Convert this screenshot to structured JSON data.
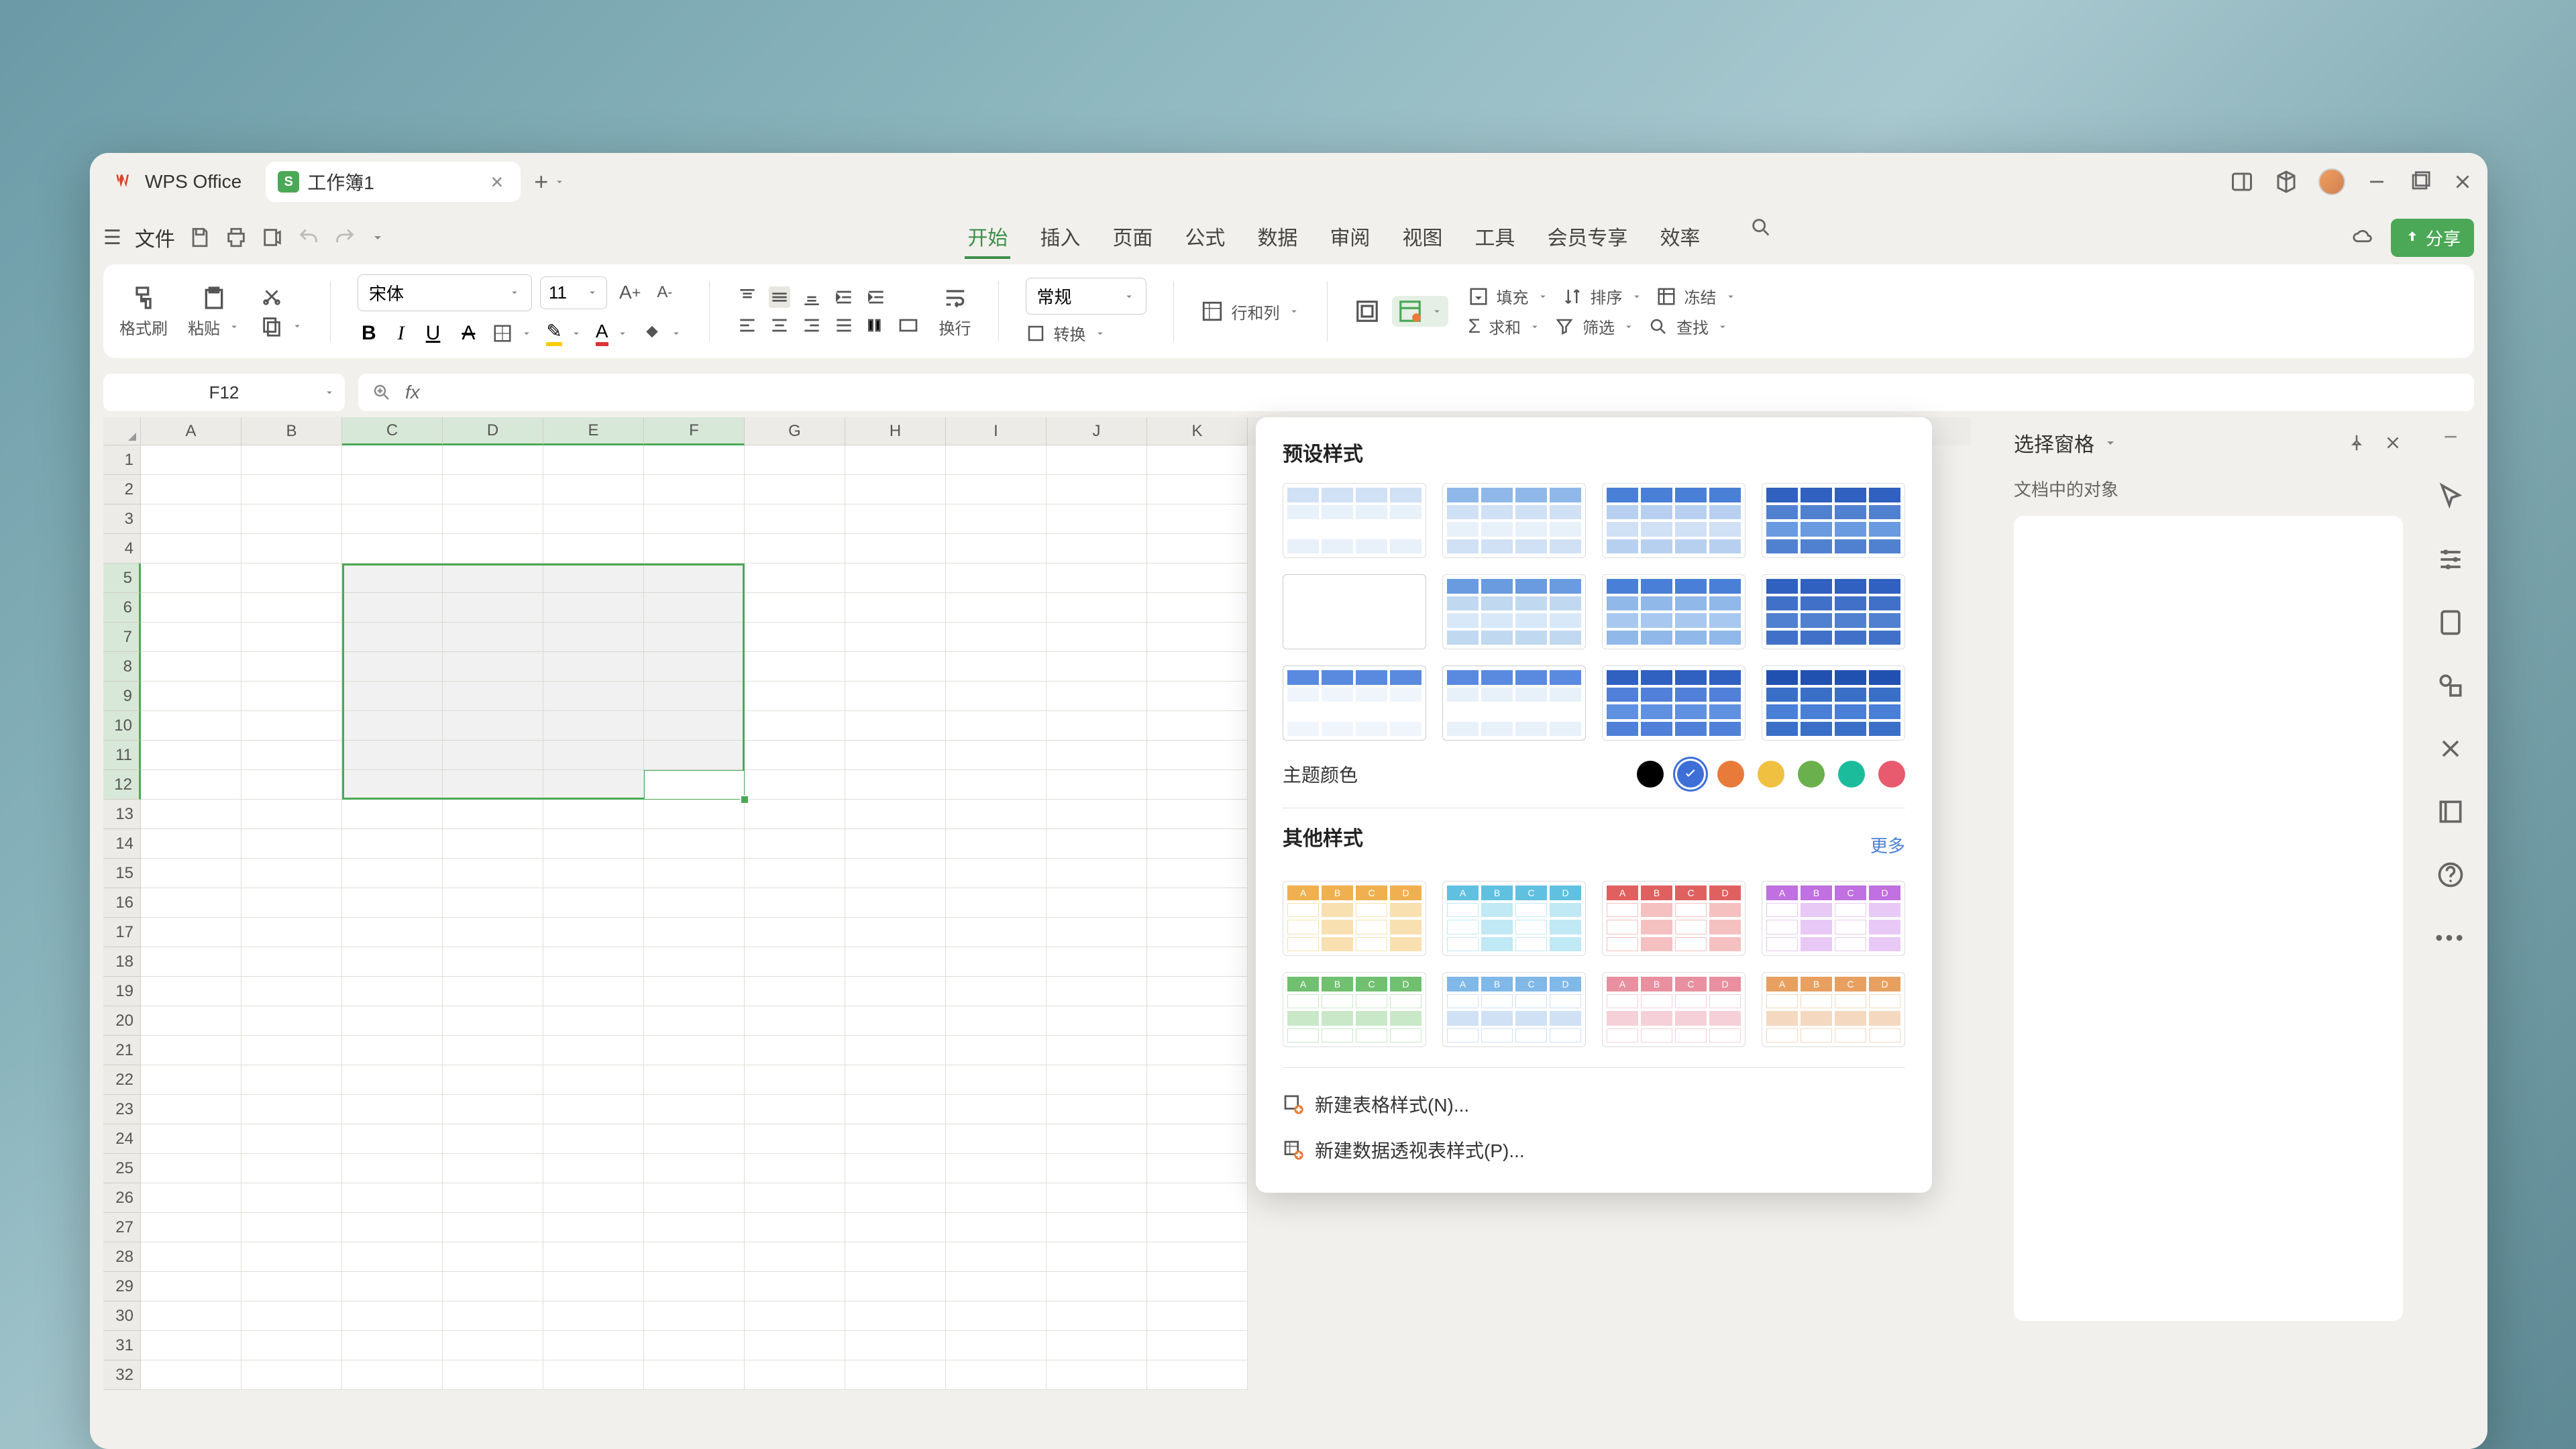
{
  "titlebar": {
    "app_name": "WPS Office",
    "file_name": "工作簿1"
  },
  "menu": {
    "file": "文件",
    "tabs": [
      "开始",
      "插入",
      "页面",
      "公式",
      "数据",
      "审阅",
      "视图",
      "工具",
      "会员专享",
      "效率"
    ],
    "active": 0,
    "share": "分享"
  },
  "ribbon": {
    "format_painter": "格式刷",
    "paste": "粘贴",
    "font": "宋体",
    "size": "11",
    "wrap": "换行",
    "number_format": "常规",
    "convert": "转换",
    "row_col": "行和列",
    "fill": "填充",
    "sort": "排序",
    "freeze": "冻结",
    "sum": "求和",
    "filter": "筛选",
    "find": "查找"
  },
  "namebox": "F12",
  "columns": [
    "A",
    "B",
    "C",
    "D",
    "E",
    "F",
    "G",
    "H",
    "I",
    "J",
    "K"
  ],
  "rows": 32,
  "selection": {
    "cols": [
      "C",
      "D",
      "E",
      "F"
    ],
    "rows": [
      5,
      6,
      7,
      8,
      9,
      10,
      11,
      12
    ]
  },
  "popup": {
    "preset_title": "预设样式",
    "theme_label": "主题颜色",
    "colors": [
      "#000000",
      "#3e6fd8",
      "#e87a3a",
      "#f0c040",
      "#6ab04c",
      "#1abc9c",
      "#e85a6e"
    ],
    "selected_color": 1,
    "other_title": "其他样式",
    "more": "更多",
    "new_table": "新建表格样式(N)...",
    "new_pivot": "新建数据透视表样式(P)..."
  },
  "side": {
    "title": "选择窗格",
    "subtitle": "文档中的对象"
  }
}
